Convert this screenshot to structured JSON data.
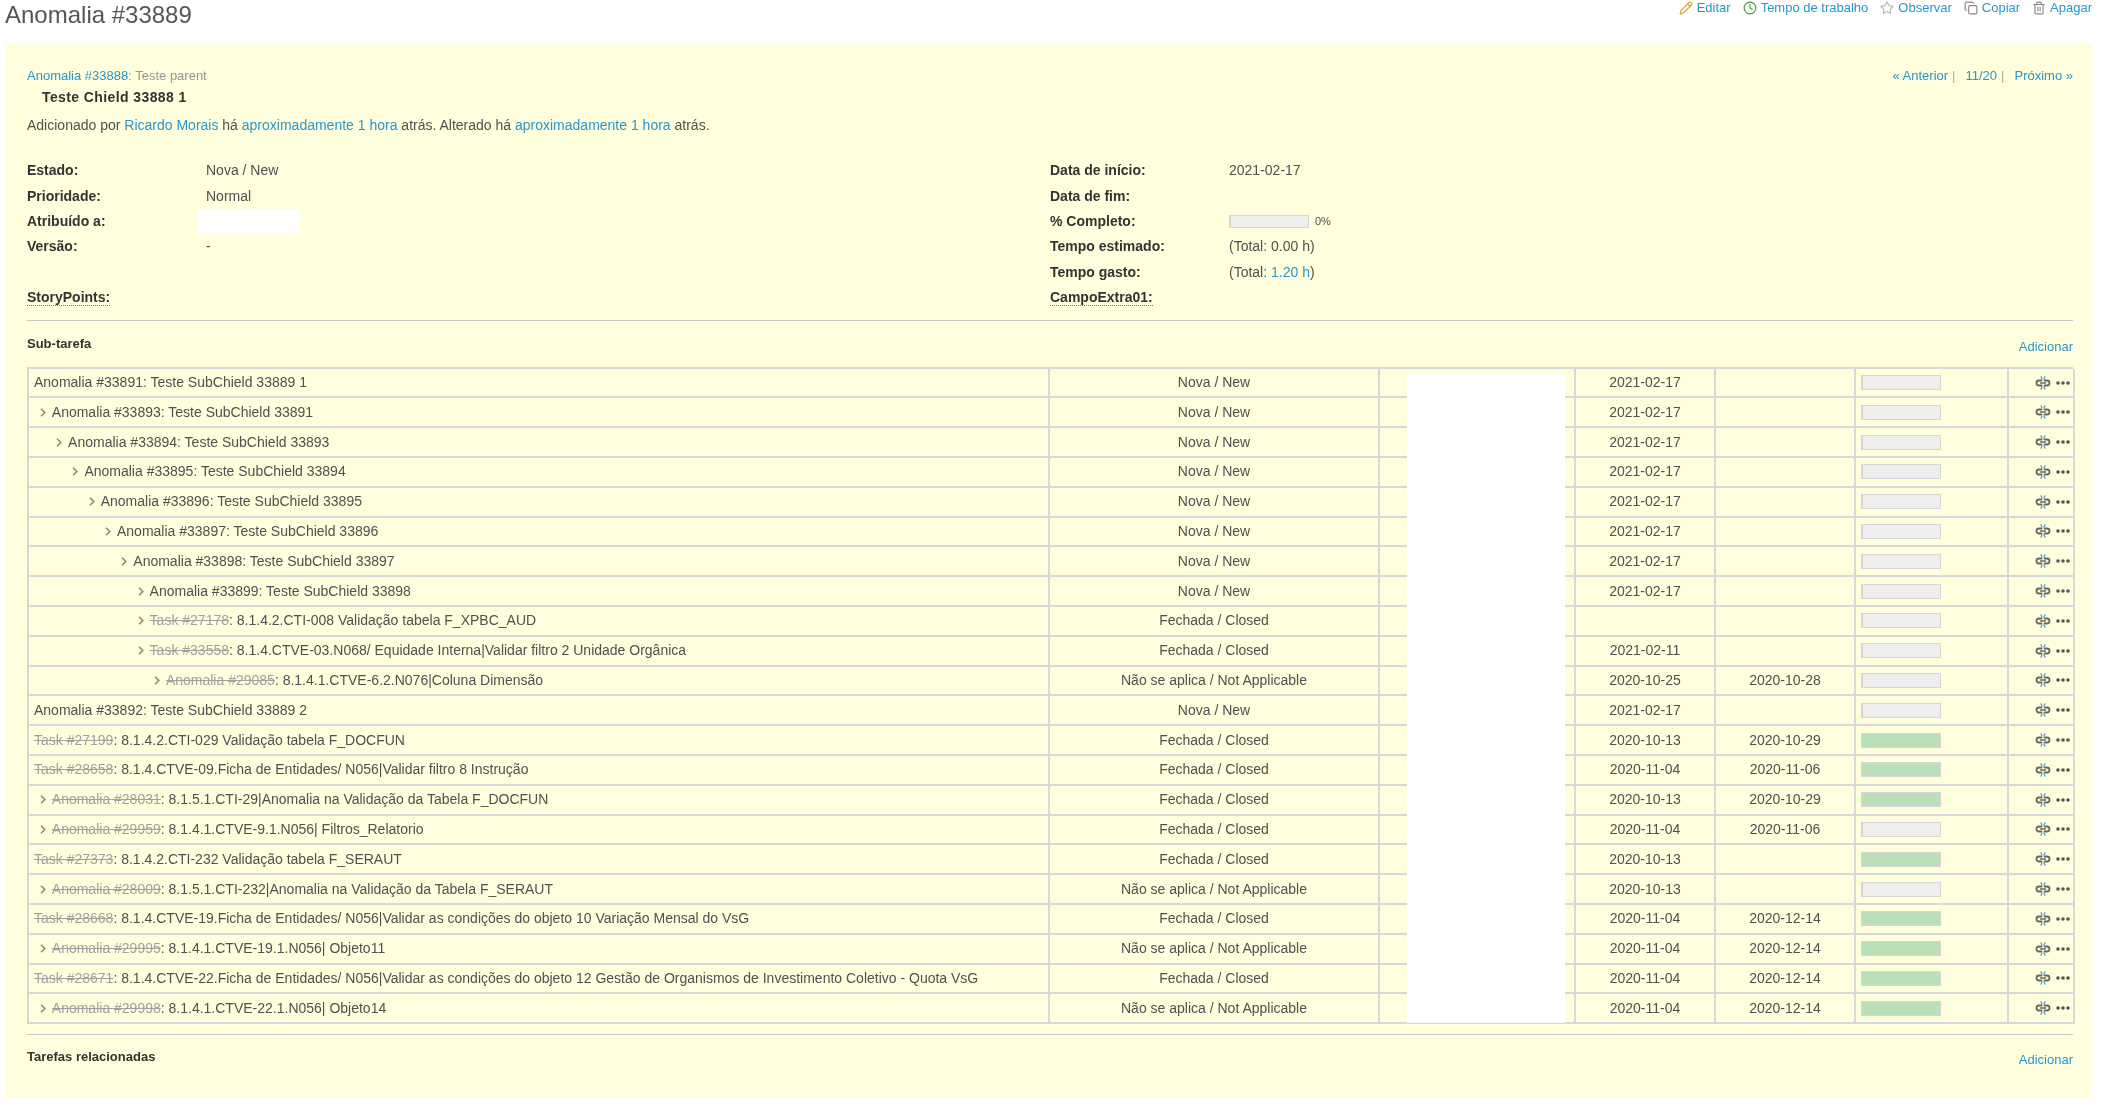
{
  "page": {
    "title": "Anomalia #33889"
  },
  "actions": [
    {
      "kind": "edit",
      "label": "Editar"
    },
    {
      "kind": "log_time",
      "label": "Tempo de trabalho"
    },
    {
      "kind": "watch",
      "label": "Observar"
    },
    {
      "kind": "copy",
      "label": "Copiar"
    },
    {
      "kind": "delete",
      "label": "Apagar"
    }
  ],
  "parent": {
    "link": "Anomalia #33888",
    "text": ": Teste parent"
  },
  "navigation": [
    {
      "kind": "link",
      "text": "« Anterior"
    },
    {
      "kind": "separator",
      "text": "|"
    },
    {
      "kind": "link",
      "text": "11/20"
    },
    {
      "kind": "separator",
      "text": "|"
    },
    {
      "kind": "link",
      "text": "Próximo »"
    }
  ],
  "subject": "Teste Chield 33888 1",
  "author_line": [
    {
      "kind": "text",
      "text": "Adicionado por "
    },
    {
      "kind": "link",
      "text": "Ricardo Morais"
    },
    {
      "kind": "text",
      "text": " há "
    },
    {
      "kind": "link",
      "text": "aproximadamente 1 hora"
    },
    {
      "kind": "text",
      "text": " atrás. Alterado há "
    },
    {
      "kind": "link",
      "text": "aproximadamente 1 hora"
    },
    {
      "kind": "text",
      "text": " atrás."
    }
  ],
  "attributes": {
    "left": [
      {
        "label": "Estado:",
        "kind": "text",
        "value": "Nova / New"
      },
      {
        "label": "Prioridade:",
        "kind": "text",
        "value": "Normal"
      },
      {
        "label": "Atribuído a:",
        "kind": "redacted"
      },
      {
        "label": "Versão:",
        "kind": "text",
        "value": "-"
      }
    ],
    "right": [
      {
        "label": "Data de início:",
        "kind": "text",
        "value": "2021-02-17"
      },
      {
        "label": "Data de fim:"
      },
      {
        "label": "% Completo:",
        "kind": "progress",
        "level": 0,
        "reading": "0%"
      },
      {
        "label": "Tempo estimado:",
        "kind": "text",
        "value": "(Total: 0.00 h)"
      },
      {
        "label": "Tempo gasto:",
        "kind": "parts",
        "parts": [
          {
            "kind": "text",
            "text": "(Total: "
          },
          {
            "kind": "link",
            "text": "1.20 h"
          },
          {
            "kind": "text",
            "text": ")"
          }
        ]
      }
    ]
  },
  "custom_fields": {
    "left": [
      {
        "label": "StoryPoints:",
        "described": true
      }
    ],
    "right": [
      {
        "label": "CampoExtra01:",
        "described": true
      }
    ]
  },
  "subtasks": {
    "title": "Sub-tarefa",
    "add_link": "Adicionar",
    "rows": [
      {
        "issue": "Anomalia #33891",
        "subject": ": Teste SubChield 33889 1",
        "closed": false,
        "status": "Nova / New",
        "start_date": "2021-02-17",
        "level": 0,
        "children": [
          {
            "issue": "Anomalia #33893",
            "subject": ": Teste SubChield 33891",
            "closed": false,
            "status": "Nova / New",
            "start_date": "2021-02-17",
            "level": 0,
            "children": [
              {
                "issue": "Anomalia #33894",
                "subject": ": Teste SubChield 33893",
                "closed": false,
                "status": "Nova / New",
                "start_date": "2021-02-17",
                "level": 0,
                "children": [
                  {
                    "issue": "Anomalia #33895",
                    "subject": ": Teste SubChield 33894",
                    "closed": false,
                    "status": "Nova / New",
                    "start_date": "2021-02-17",
                    "level": 0,
                    "children": [
                      {
                        "issue": "Anomalia #33896",
                        "subject": ": Teste SubChield 33895",
                        "closed": false,
                        "status": "Nova / New",
                        "start_date": "2021-02-17",
                        "level": 0,
                        "children": [
                          {
                            "issue": "Anomalia #33897",
                            "subject": ": Teste SubChield 33896",
                            "closed": false,
                            "status": "Nova / New",
                            "start_date": "2021-02-17",
                            "level": 0,
                            "children": [
                              {
                                "issue": "Anomalia #33898",
                                "subject": ": Teste SubChield 33897",
                                "closed": false,
                                "status": "Nova / New",
                                "start_date": "2021-02-17",
                                "level": 0,
                                "children": [
                                  {
                                    "issue": "Anomalia #33899",
                                    "subject": ": Teste SubChield 33898",
                                    "closed": false,
                                    "status": "Nova / New",
                                    "start_date": "2021-02-17",
                                    "level": 0
                                  },
                                  {
                                    "issue": "Task #27178",
                                    "subject": ": 8.1.4.2.CTI-008 Validação tabela F_XPBC_AUD",
                                    "closed": true,
                                    "status": "Fechada / Closed",
                                    "level": 0
                                  },
                                  {
                                    "issue": "Task #33558",
                                    "subject": ": 8.1.4.CTVE-03.N068/ Equidade Interna|Validar filtro 2 Unidade Orgânica",
                                    "closed": true,
                                    "status": "Fechada / Closed",
                                    "start_date": "2021-02-11",
                                    "level": 0,
                                    "children": [
                                      {
                                        "issue": "Anomalia #29085",
                                        "subject": ": 8.1.4.1.CTVE-6.2.N076|Coluna Dimensão",
                                        "closed": true,
                                        "status": "Não se aplica / Not Applicable",
                                        "start_date": "2020-10-25",
                                        "due_date": "2020-10-28",
                                        "level": 0
                                      }
                                    ]
                                  }
                                ]
                              }
                            ]
                          }
                        ]
                      }
                    ]
                  }
                ]
              }
            ]
          }
        ]
      },
      {
        "issue": "Anomalia #33892",
        "subject": ": Teste SubChield 33889 2",
        "closed": false,
        "status": "Nova / New",
        "start_date": "2021-02-17",
        "level": 0
      },
      {
        "issue": "Task #27199",
        "subject": ": 8.1.4.2.CTI-029 Validação tabela F_DOCFUN",
        "closed": true,
        "status": "Fechada / Closed",
        "start_date": "2020-10-13",
        "due_date": "2020-10-29",
        "level": 1
      },
      {
        "issue": "Task #28658",
        "subject": ": 8.1.4.CTVE-09.Ficha de Entidades/ N056|Validar filtro 8 Instrução",
        "closed": true,
        "status": "Fechada / Closed",
        "start_date": "2020-11-04",
        "due_date": "2020-11-06",
        "level": 1,
        "children": [
          {
            "issue": "Anomalia #28031",
            "subject": ": 8.1.5.1.CTI-29|Anomalia na Validação da Tabela F_DOCFUN",
            "closed": true,
            "status": "Fechada / Closed",
            "start_date": "2020-10-13",
            "due_date": "2020-10-29",
            "level": 1
          },
          {
            "issue": "Anomalia #29959",
            "subject": ": 8.1.4.1.CTVE-9.1.N056| Filtros_Relatorio",
            "closed": true,
            "status": "Fechada / Closed",
            "start_date": "2020-11-04",
            "due_date": "2020-11-06",
            "level": 0
          }
        ]
      },
      {
        "issue": "Task #27373",
        "subject": ": 8.1.4.2.CTI-232 Validação tabela F_SERAUT",
        "closed": true,
        "status": "Fechada / Closed",
        "start_date": "2020-10-13",
        "level": 1,
        "children": [
          {
            "issue": "Anomalia #28009",
            "subject": ": 8.1.5.1.CTI-232|Anomalia na Validação da Tabela F_SERAUT",
            "closed": true,
            "status": "Não se aplica / Not Applicable",
            "start_date": "2020-10-13",
            "level": 0
          }
        ]
      },
      {
        "issue": "Task #28668",
        "subject": ": 8.1.4.CTVE-19.Ficha de Entidades/ N056|Validar as condições do objeto 10 Variação Mensal do VsG",
        "closed": true,
        "status": "Fechada / Closed",
        "start_date": "2020-11-04",
        "due_date": "2020-12-14",
        "level": 1,
        "children": [
          {
            "issue": "Anomalia #29995",
            "subject": ": 8.1.4.1.CTVE-19.1.N056| Objeto11",
            "closed": true,
            "status": "Não se aplica / Not Applicable",
            "start_date": "2020-11-04",
            "due_date": "2020-12-14",
            "level": 1
          }
        ]
      },
      {
        "issue": "Task #28671",
        "subject": ": 8.1.4.CTVE-22.Ficha de Entidades/ N056|Validar as condições do objeto 12 Gestão de Organismos de Investimento Coletivo - Quota VsG",
        "closed": true,
        "status": "Fechada / Closed",
        "start_date": "2020-11-04",
        "due_date": "2020-12-14",
        "level": 1,
        "children": [
          {
            "issue": "Anomalia #29998",
            "subject": ": 8.1.4.1.CTVE-22.1.N056| Objeto14",
            "closed": true,
            "status": "Não se aplica / Not Applicable",
            "start_date": "2020-11-04",
            "due_date": "2020-12-14",
            "level": 1
          }
        ]
      }
    ]
  },
  "related": {
    "title": "Tarefas relacionadas",
    "add_link": "Adicionar"
  }
}
